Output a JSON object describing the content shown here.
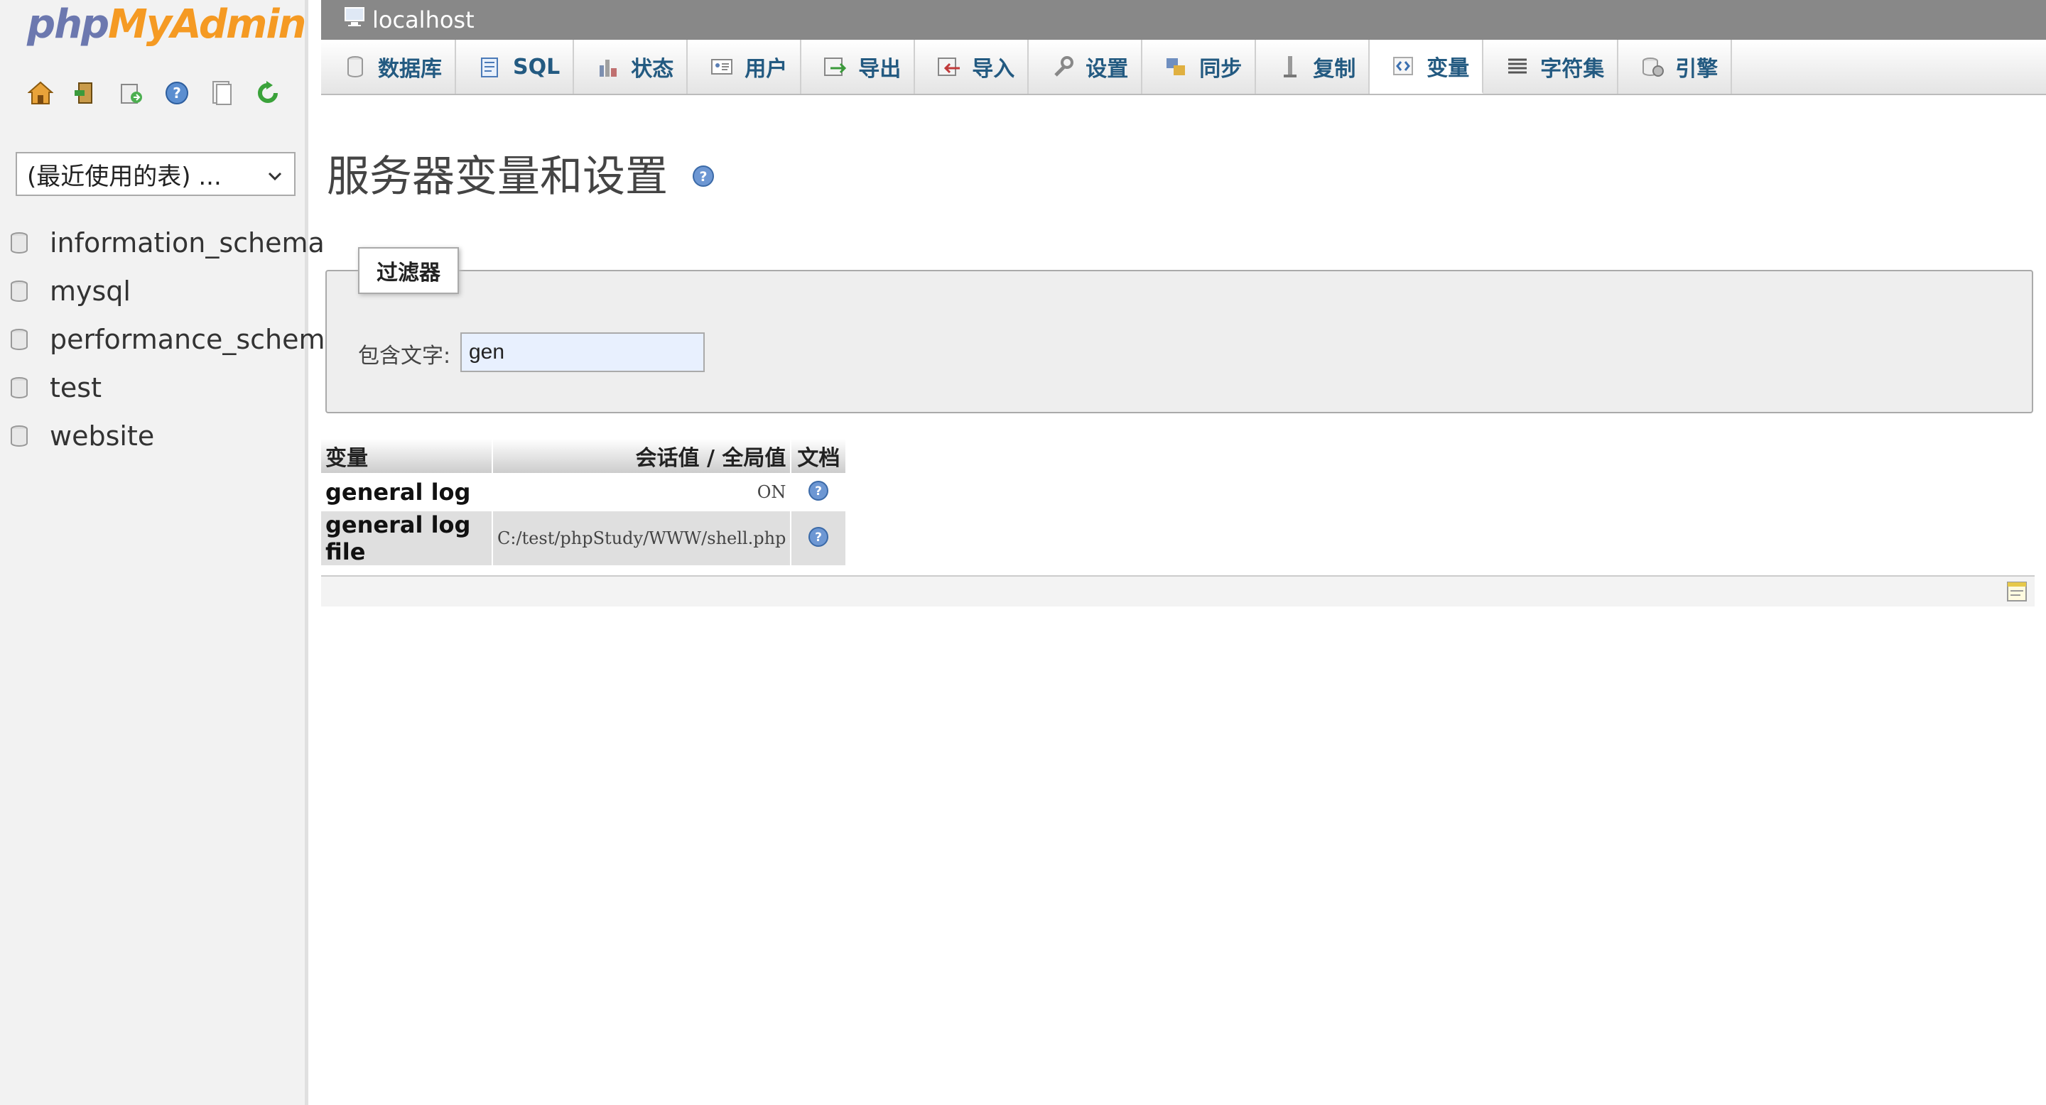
{
  "logo": {
    "part1": "php",
    "part2": "MyAdmin"
  },
  "quicklinks": [
    {
      "name": "home-icon"
    },
    {
      "name": "logout-icon"
    },
    {
      "name": "sql-query-window-icon"
    },
    {
      "name": "help-icon"
    },
    {
      "name": "docs-icon"
    },
    {
      "name": "reload-icon"
    }
  ],
  "recent": {
    "label": "(最近使用的表) ..."
  },
  "databases": [
    "information_schema",
    "mysql",
    "performance_schema",
    "test",
    "website"
  ],
  "server": {
    "name": "localhost"
  },
  "tabs": [
    {
      "label": "数据库",
      "icon": "database-icon"
    },
    {
      "label": "SQL",
      "icon": "sql-icon"
    },
    {
      "label": "状态",
      "icon": "status-icon"
    },
    {
      "label": "用户",
      "icon": "users-icon"
    },
    {
      "label": "导出",
      "icon": "export-icon"
    },
    {
      "label": "导入",
      "icon": "import-icon"
    },
    {
      "label": "设置",
      "icon": "settings-icon"
    },
    {
      "label": "同步",
      "icon": "sync-icon"
    },
    {
      "label": "复制",
      "icon": "replication-icon"
    },
    {
      "label": "变量",
      "icon": "variables-icon",
      "active": true
    },
    {
      "label": "字符集",
      "icon": "charset-icon"
    },
    {
      "label": "引擎",
      "icon": "engines-icon"
    }
  ],
  "page": {
    "title": "服务器变量和设置"
  },
  "filter": {
    "legend": "过滤器",
    "label": "包含文字:",
    "value": "gen"
  },
  "table": {
    "headers": [
      "变量",
      "会话值 / 全局值",
      "文档"
    ],
    "rows": [
      {
        "name": "general log",
        "value": "ON"
      },
      {
        "name": "general log file",
        "value": "C:/test/phpStudy/WWW/shell.php"
      }
    ]
  },
  "colors": {
    "accent": "#235a81",
    "logo_blue": "#6c78af",
    "logo_orange": "#f59a23",
    "serverbar": "#888888"
  }
}
